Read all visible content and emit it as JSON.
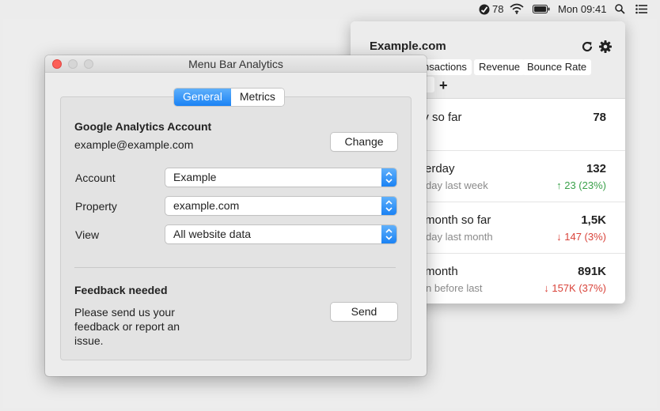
{
  "menubar": {
    "weather_value": "78",
    "clock": "Mon 09:41",
    "icons": [
      "analytics-status-icon",
      "wifi-icon",
      "battery-icon",
      "spotlight-search-icon",
      "notification-list-icon"
    ]
  },
  "popover": {
    "site_title": "Example.com",
    "tabs": [
      "nsactions",
      "Revenue",
      "Bounce Rate"
    ],
    "add_tab_label": "+",
    "stats": [
      {
        "label": "ay so far",
        "sub": "",
        "value": "78",
        "change": ""
      },
      {
        "label": "erday",
        "sub": "day last week",
        "value": "132",
        "change": "↑ 23 (23%)",
        "direction": "up"
      },
      {
        "label": "month so far",
        "sub": "day last month",
        "value": "1,5K",
        "change": "↓ 147 (3%)",
        "direction": "down"
      },
      {
        "label": "month",
        "sub": "n before last",
        "value": "891K",
        "change": "↓ 157K (37%)",
        "direction": "down"
      }
    ],
    "colors": {
      "up": "#3aa14a",
      "down": "#d9433a"
    }
  },
  "window": {
    "title": "Menu Bar Analytics",
    "segments": [
      "General",
      "Metrics"
    ],
    "active_segment": "General",
    "account_section": {
      "title": "Google Analytics Account",
      "email": "example@example.com",
      "change_button": "Change"
    },
    "form": {
      "account_label": "Account",
      "account_value": "Example",
      "property_label": "Property",
      "property_value": "example.com",
      "view_label": "View",
      "view_value": "All website data"
    },
    "feedback": {
      "title": "Feedback needed",
      "line1": "Please send us your",
      "line2": "feedback or report an",
      "line3": "issue.",
      "send_button": "Send"
    },
    "accent": "#1a82f4"
  }
}
